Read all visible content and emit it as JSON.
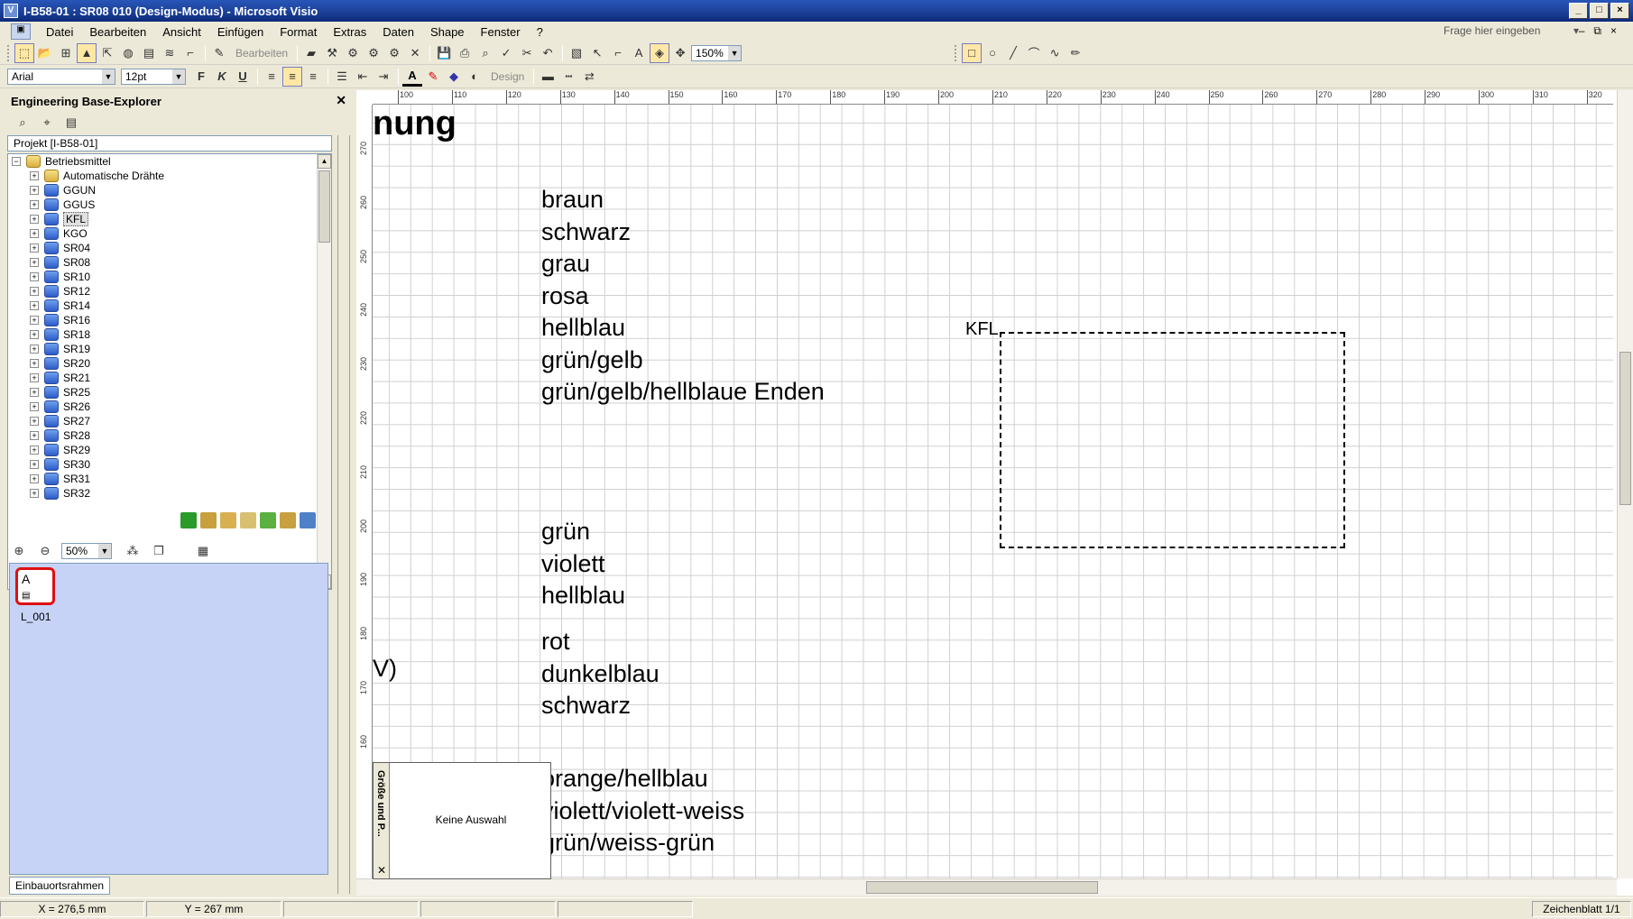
{
  "window": {
    "title": "I-B58-01 : SR08 010 (Design-Modus) - Microsoft Visio"
  },
  "menu": {
    "items": [
      "Datei",
      "Bearbeiten",
      "Ansicht",
      "Einfügen",
      "Format",
      "Extras",
      "Daten",
      "Shape",
      "Fenster",
      "?"
    ],
    "ask_placeholder": "Frage hier eingeben"
  },
  "toolbar": {
    "edit_label": "Bearbeiten",
    "zoom": "150%",
    "font_name": "Arial",
    "font_size": "12pt",
    "bold": "F",
    "italic": "K",
    "underline": "U",
    "design_label": "Design"
  },
  "explorer": {
    "title": "Engineering Base-Explorer",
    "project_label": "Projekt [I-B58-01]",
    "tree": {
      "root": "Betriebsmittel",
      "items": [
        "Automatische Drähte",
        "GGUN",
        "GGUS",
        "KFL",
        "KGO",
        "SR04",
        "SR08",
        "SR10",
        "SR12",
        "SR14",
        "SR16",
        "SR18",
        "SR19",
        "SR20",
        "SR21",
        "SR25",
        "SR26",
        "SR27",
        "SR28",
        "SR29",
        "SR30",
        "SR31",
        "SR32"
      ],
      "selected": "KFL"
    },
    "zoom": "50%",
    "page_label": "L_001",
    "tab": "Einbauortsrahmen"
  },
  "ruler": {
    "h_ticks": [
      "100",
      "110",
      "120",
      "130",
      "140",
      "150",
      "160",
      "170",
      "180",
      "190",
      "200",
      "210",
      "220",
      "230",
      "240",
      "250",
      "260",
      "270",
      "280",
      "290",
      "300",
      "310",
      "320"
    ],
    "v_ticks": [
      "270",
      "260",
      "250",
      "240",
      "230",
      "220",
      "210",
      "200",
      "190",
      "180",
      "170",
      "160"
    ]
  },
  "drawing": {
    "heading_fragment": "nung",
    "colors_group1": [
      "braun",
      "schwarz",
      "grau",
      "rosa",
      "hellblau",
      "grün/gelb",
      "grün/gelb/hellblaue Enden"
    ],
    "colors_group2": [
      "grün",
      "violett",
      "hellblau"
    ],
    "colors_group3": [
      "rot",
      "dunkelblau",
      "schwarz"
    ],
    "left_fragment": "V)",
    "colors_group4": [
      "orange/hellblau",
      "violett/violett-weiss",
      "grün/weiss-grün"
    ],
    "frame_label": "KFL"
  },
  "size_panel": {
    "title": "Größe und P...",
    "message": "Keine Auswahl"
  },
  "status": {
    "x": "X = 276,5 mm",
    "y": "Y = 267 mm",
    "sheet": "Zeichenblatt 1/1"
  }
}
